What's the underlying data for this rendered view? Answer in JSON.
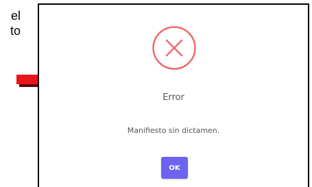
{
  "page_text": [
    "el",
    "to"
  ],
  "dialog": {
    "icon": "error-circle-x-icon",
    "title": "Error",
    "message": "Manifiesto sin dictamen.",
    "ok_label": "OK"
  },
  "annotation": {
    "icon": "red-arrow-right-icon"
  },
  "colors": {
    "error_icon": "#f06a6a",
    "button": "#6c63f0",
    "arrow": "#e8151b",
    "text": "#555555"
  }
}
